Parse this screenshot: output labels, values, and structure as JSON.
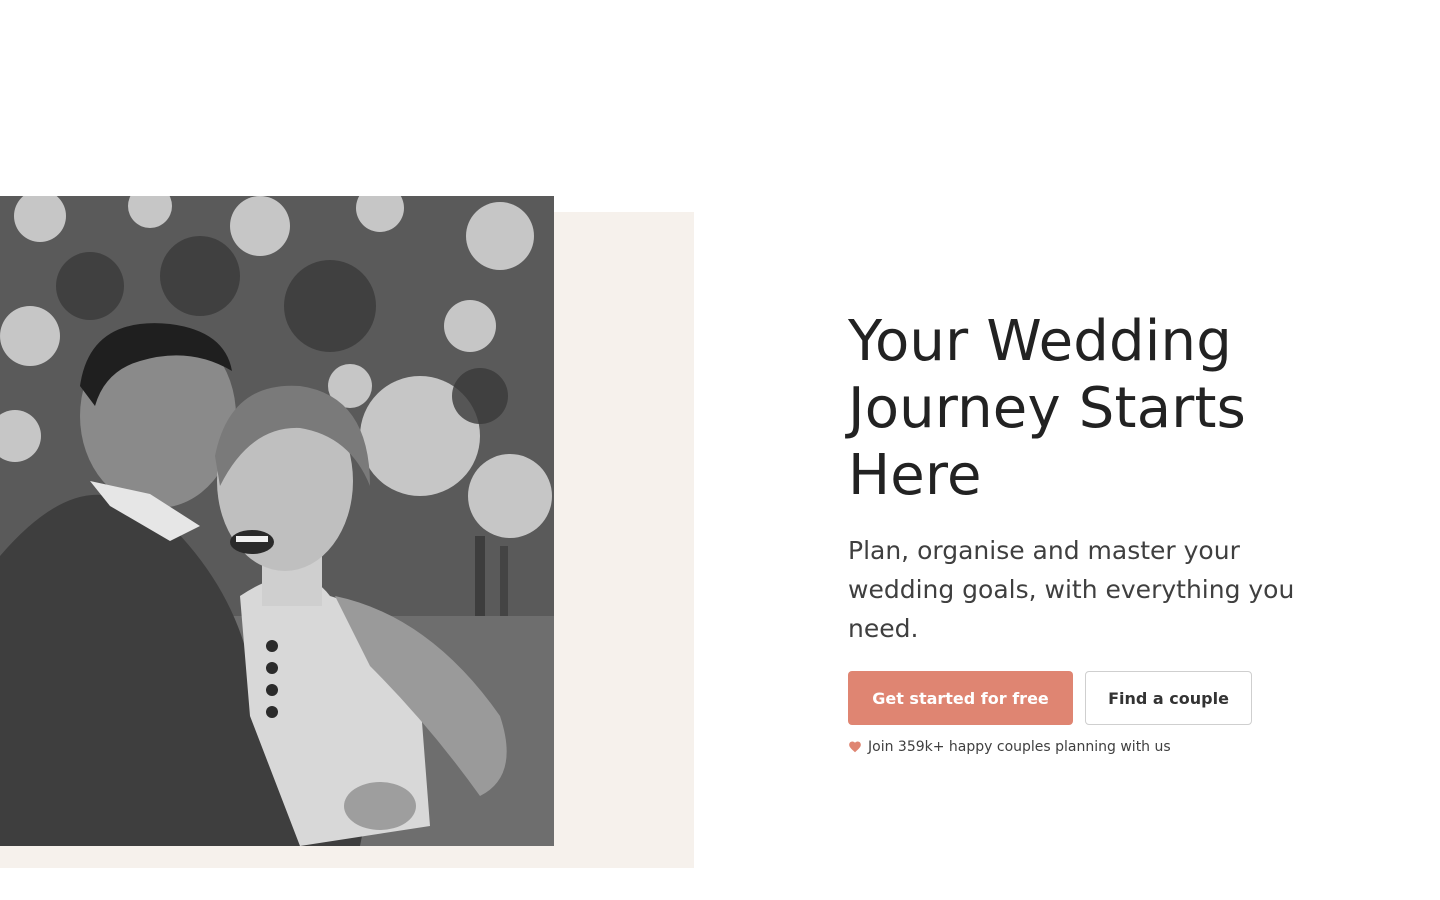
{
  "hero": {
    "title": "Your Wedding Journey Starts Here",
    "subtitle": "Plan, organise and master your wedding goals, with everything you need.",
    "primary_cta": "Get started for free",
    "secondary_cta": "Find a couple",
    "social_proof": "Join 359k+ happy couples planning with us",
    "social_proof_icon": "heart-icon"
  },
  "photo": {
    "icon": "couple-photo",
    "style": "black-and-white"
  },
  "colors": {
    "accent": "#df8572",
    "panel": "#f6f1ec",
    "text": "#222222"
  }
}
